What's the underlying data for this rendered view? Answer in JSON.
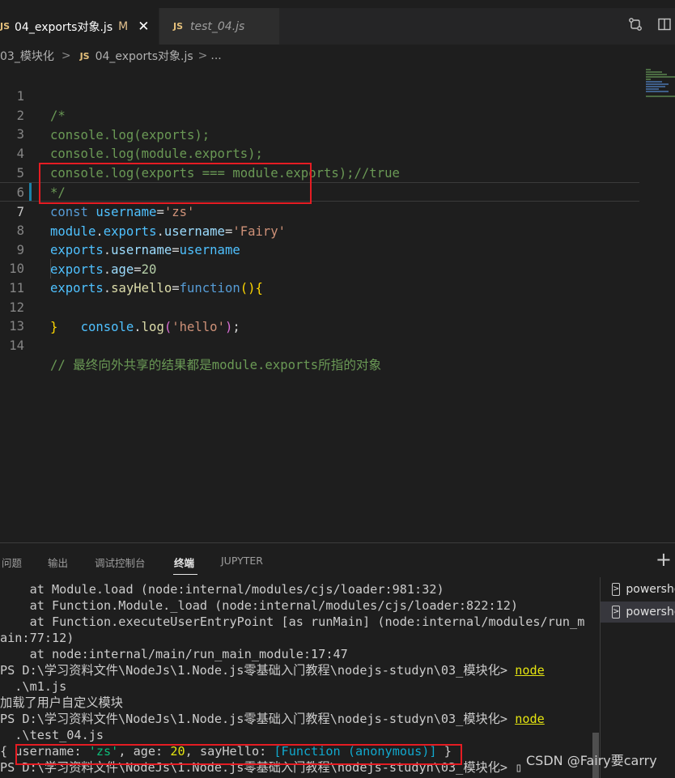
{
  "tabs": [
    {
      "icon": "JS",
      "label": "04_exports对象.js",
      "modified": "M",
      "close": "✕"
    },
    {
      "icon": "JS",
      "label": "test_04.js"
    }
  ],
  "breadcrumb": {
    "folder": "03_模块化",
    "sep": ">",
    "icon": "JS",
    "file": "04_exports对象.js",
    "more": "..."
  },
  "editor": {
    "line_numbers": [
      "1",
      "2",
      "3",
      "4",
      "5",
      "6",
      "7",
      "8",
      "9",
      "10",
      "11",
      "12",
      "13",
      "14"
    ],
    "code": {
      "l1": "/*",
      "l2": "console.log(exports);",
      "l3": "console.log(module.exports);",
      "l4": "console.log(exports === module.exports);//true",
      "l5": "*/",
      "l6": {
        "kw": "const",
        "var": "username",
        "eq": "=",
        "str": "'zs'"
      },
      "l7": {
        "a": "module",
        "d1": ".",
        "b": "exports",
        "d2": ".",
        "c": "username",
        "eq": "=",
        "str": "'Fairy'"
      },
      "l8": {
        "a": "exports",
        "d1": ".",
        "b": "username",
        "eq": "=",
        "c": "username"
      },
      "l9": {
        "a": "exports",
        "d1": ".",
        "b": "age",
        "eq": "=",
        "num": "20"
      },
      "l10": {
        "a": "exports",
        "d1": ".",
        "b": "sayHello",
        "eq": "=",
        "kw": "function",
        "p": "()",
        "br": "{"
      },
      "l11": {
        "indent": "    ",
        "a": "console",
        "d": ".",
        "fn": "log",
        "p1": "(",
        "str": "'hello'",
        "p2": ")",
        "semi": ";"
      },
      "l12": "}",
      "l14": "// 最终向外共享的结果都是module.exports所指的对象"
    }
  },
  "panel": {
    "tabs": [
      "问题",
      "输出",
      "调试控制台",
      "终端",
      "JUPYTER"
    ],
    "active_tab": "终端",
    "plus": "+"
  },
  "terminal": {
    "lines": {
      "t1": "    at Module.load (node:internal/modules/cjs/loader:981:32)",
      "t2": "    at Function.Module._load (node:internal/modules/cjs/loader:822:12)",
      "t3": "    at Function.executeUserEntryPoint [as runMain] (node:internal/modules/run_m",
      "t4": "ain:77:12)",
      "t5": "    at node:internal/main/run_main_module:17:47",
      "t6_prompt": "PS D:\\学习资料文件\\NodeJs\\1.Node.js零基础入门教程\\nodejs-studyn\\03_模块化> ",
      "t6_cmd": "node",
      "t7": "  .\\m1.js",
      "t8": "加载了用户自定义模块",
      "t9_prompt": "PS D:\\学习资料文件\\NodeJs\\1.Node.js零基础入门教程\\nodejs-studyn\\03_模块化> ",
      "t9_cmd": "node",
      "t10": "  .\\test_04.js",
      "t11": {
        "open": "{ ",
        "k1": "username:",
        "v1": "'zs'",
        "c1": ", ",
        "k2": "age:",
        "v2": "20",
        "c2": ", ",
        "k3": "sayHello:",
        "v3": "[Function (anonymous)]",
        "close": " }"
      },
      "t12_prompt": "PS D:\\学习资料文件\\NodeJs\\1.Node.js零基础入门教程\\nodejs-studyn\\03_模块化> ",
      "t12_cursor": "▯"
    },
    "instances": [
      "powershell",
      "powershell"
    ]
  },
  "watermark": "CSDN @Fairy要carry",
  "colors": {
    "highlight": "#e51c23",
    "accent": "#1b81a8"
  }
}
